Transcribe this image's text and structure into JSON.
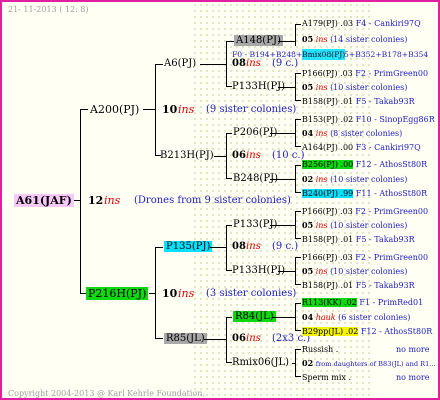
{
  "header": {
    "date_text": "21- 11-2013 ( 12:  8)"
  },
  "footer": {
    "copyright": "Copyright 2004-2013 @ Karl Kehrle Foundation."
  },
  "root": {
    "label": "A61(JAF)",
    "num": "12",
    "ins": "ins",
    "note": "(Drones from 9 sister colonies)"
  },
  "gen1": [
    {
      "label": "A200(PJ)",
      "num": "10",
      "ins": "ins",
      "note": "(9 sister colonies)"
    },
    {
      "label": "P216H(PJ)",
      "num": "10",
      "ins": "ins",
      "note": "(3 sister colonies)"
    }
  ],
  "gen2": [
    {
      "label": "A6(PJ)",
      "num": "08",
      "ins": "ins",
      "note": "(9 c.)"
    },
    {
      "label": "B213H(PJ)",
      "num": "06",
      "ins": "ins",
      "note": "(10 c.)"
    },
    {
      "label": "P135(PJ)",
      "num": "08",
      "ins": "ins",
      "note": "(9 c.)"
    },
    {
      "label": "R85(JL)",
      "num": "06",
      "ins": "ins",
      "note": "(2x3 c.)"
    }
  ],
  "gen3": [
    {
      "label": "A148(PJ)"
    },
    {
      "label": "P133H(PJ)"
    },
    {
      "label": "P206(PJ)"
    },
    {
      "label": "B248(PJ)"
    },
    {
      "label": "P133(PJ)"
    },
    {
      "label": "P133H(PJ)"
    },
    {
      "label": "R84(JL)"
    },
    {
      "label": "Rmix06(JL)"
    }
  ],
  "right": [
    {
      "a": "A179(PJ) .03",
      "b": "F4 - Cankiri97Q"
    },
    {
      "a": "05",
      "ins": "ins",
      "c": "(14 sister colonies)"
    },
    {
      "a": "F0 - B194+B248+B194+B175+B352+B178+B354",
      "overlay": "Bmix08(PJ)"
    },
    {
      "a": "P166(PJ) .03",
      "b": "F2 - PrimGreen00"
    },
    {
      "a": "05",
      "ins": "ins",
      "c": "(10 sister colonies)"
    },
    {
      "a": "B158(PJ) .01",
      "b": "F5 - Takab93R"
    },
    {
      "a": "B153(PJ) .02",
      "b": "F10 - SinopEgg86R"
    },
    {
      "a": "04",
      "ins": "ins",
      "c": "(8 sister colonies)"
    },
    {
      "a": "A164(PJ) .00",
      "b": "F3 - Cankiri97Q"
    },
    {
      "a": "B256(PJ) .00",
      "b": "F12 - AthosSt80R"
    },
    {
      "a": "02",
      "ins": "ins",
      "c": "(10 sister colonies)"
    },
    {
      "a": "B240(PJ) .99",
      "b": "F11 - AthosSt80R"
    },
    {
      "a": "P166(PJ) .03",
      "b": "F2 - PrimGreen00"
    },
    {
      "a": "05",
      "ins": "ins",
      "c": "(10 sister colonies)"
    },
    {
      "a": "B158(PJ) .01",
      "b": "F5 - Takab93R"
    },
    {
      "a": "P166(PJ) .03",
      "b": "F2 - PrimGreen00"
    },
    {
      "a": "05",
      "ins": "ins",
      "c": "(10 sister colonies)"
    },
    {
      "a": "B158(PJ) .01",
      "b": "F5 - Takab93R"
    },
    {
      "a": "R113(KK) .02",
      "b": "F1 - PrimRed01"
    },
    {
      "a": "04",
      "ins": "hauk",
      "c": "(6 sister colonies)"
    },
    {
      "a": "B29pp(JL) .02",
      "b": "F12 - AthosSt80R"
    },
    {
      "a": "Russish .",
      "b": "no more"
    },
    {
      "a": "02",
      "c": "from daughters of B83(JL) and R1..."
    },
    {
      "a": "Sperm mix .",
      "b": "no more"
    }
  ],
  "colors": {
    "border": "#e020a0",
    "ins": "#d80000",
    "link_blue": "#1c1cc0",
    "root_bg": "#f8c8f8",
    "cyan": "#00e0ff",
    "green": "#10d810",
    "gray": "#a8a8a8",
    "yellow": "#f4f400"
  }
}
